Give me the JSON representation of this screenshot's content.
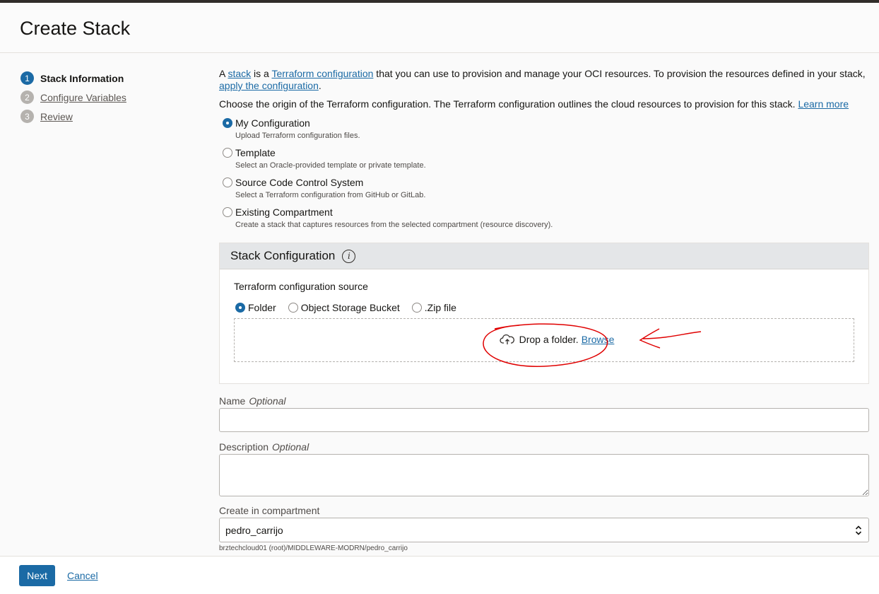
{
  "page": {
    "title": "Create Stack"
  },
  "steps": [
    {
      "num": "1",
      "label": "Stack Information",
      "active": true
    },
    {
      "num": "2",
      "label": "Configure Variables",
      "active": false
    },
    {
      "num": "3",
      "label": "Review",
      "active": false
    }
  ],
  "intro": {
    "p1_a": "A ",
    "p1_link1": "stack",
    "p1_b": " is a ",
    "p1_link2": "Terraform configuration",
    "p1_c": " that you can use to provision and manage your OCI resources. To provision the resources defined in your stack, ",
    "p1_link3": "apply the configuration",
    "p1_d": ".",
    "p2": "Choose the origin of the Terraform configuration. The Terraform configuration outlines the cloud resources to provision for this stack. ",
    "p2_link": "Learn more"
  },
  "origins": [
    {
      "label": "My Configuration",
      "desc": "Upload Terraform configuration files.",
      "checked": true
    },
    {
      "label": "Template",
      "desc": "Select an Oracle-provided template or private template.",
      "checked": false
    },
    {
      "label": "Source Code Control System",
      "desc": "Select a Terraform configuration from GitHub or GitLab.",
      "checked": false
    },
    {
      "label": "Existing Compartment",
      "desc": "Create a stack that captures resources from the selected compartment (resource discovery).",
      "checked": false
    }
  ],
  "stack_config": {
    "title": "Stack Configuration",
    "info_icon": "info-icon",
    "source_label": "Terraform configuration source",
    "sources": [
      {
        "label": "Folder",
        "checked": true
      },
      {
        "label": "Object Storage Bucket",
        "checked": false
      },
      {
        "label": ".Zip file",
        "checked": false
      }
    ],
    "drop_text": "Drop a folder.",
    "browse_text": "Browse"
  },
  "fields": {
    "name_label": "Name",
    "name_optional": "Optional",
    "name_value": "",
    "desc_label": "Description",
    "desc_optional": "Optional",
    "desc_value": "",
    "compartment_label": "Create in compartment",
    "compartment_value": "pedro_carrijo",
    "compartment_path": "brztechcloud01 (root)/MIDDLEWARE-MODRN/pedro_carrijo"
  },
  "footer": {
    "next": "Next",
    "cancel": "Cancel"
  },
  "colors": {
    "accent": "#1b6aa5",
    "annotation": "#e00000"
  }
}
